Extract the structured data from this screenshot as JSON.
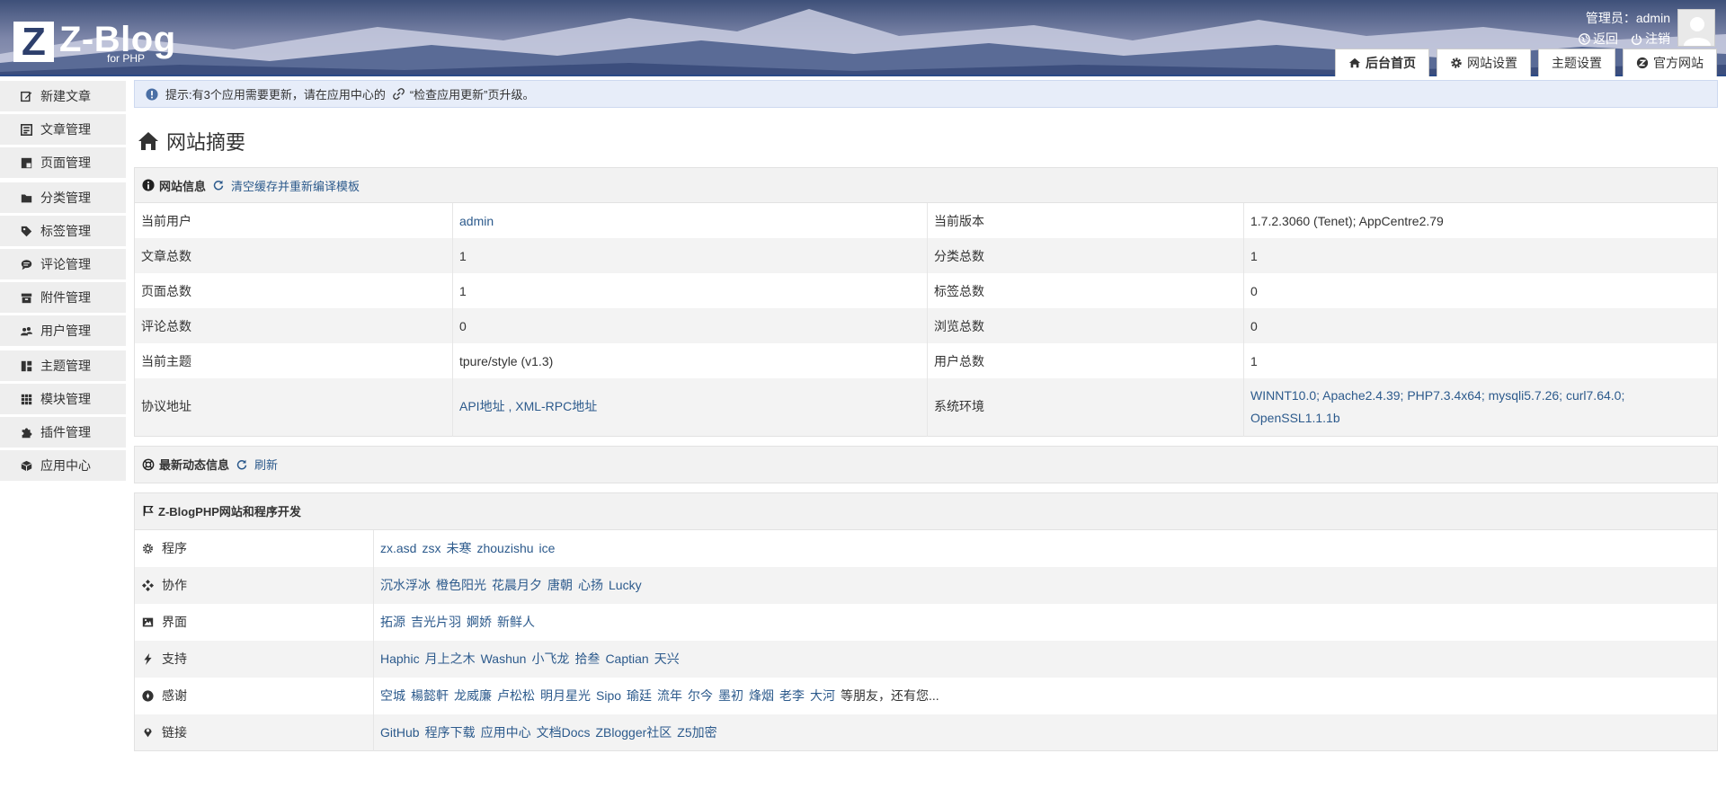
{
  "header": {
    "logo_text": "Z-Blog",
    "logo_z": "Z",
    "logo_sub": "for PHP",
    "admin_label": "管理员：admin",
    "back_link": "返回",
    "logout_link": "注销",
    "tabs": [
      {
        "label": "后台首页",
        "icon": "home-icon"
      },
      {
        "label": "网站设置",
        "icon": "gear-icon"
      },
      {
        "label": "主题设置",
        "icon": ""
      },
      {
        "label": "官方网站",
        "icon": "zblog-icon"
      }
    ]
  },
  "sidebar": {
    "items": [
      {
        "label": "新建文章",
        "icon": "edit-icon"
      },
      {
        "label": "文章管理",
        "icon": "article-icon"
      },
      {
        "label": "页面管理",
        "icon": "page-icon"
      },
      {
        "label": "分类管理",
        "icon": "folder-icon"
      },
      {
        "label": "标签管理",
        "icon": "tag-icon"
      },
      {
        "label": "评论管理",
        "icon": "comment-icon"
      },
      {
        "label": "附件管理",
        "icon": "archive-icon"
      },
      {
        "label": "用户管理",
        "icon": "users-icon"
      },
      {
        "label": "主题管理",
        "icon": "theme-icon"
      },
      {
        "label": "模块管理",
        "icon": "grid-icon"
      },
      {
        "label": "插件管理",
        "icon": "puzzle-icon"
      },
      {
        "label": "应用中心",
        "icon": "box-icon"
      }
    ]
  },
  "notice": {
    "text_before": "提示:有3个应用需要更新，请在应用中心的",
    "text_after": "“检查应用更新”页升级。"
  },
  "page_title": "网站摘要",
  "site_info": {
    "heading": "网站信息",
    "action": "清空缓存并重新编译模板",
    "rows": [
      {
        "k1": "当前用户",
        "v1": "admin",
        "k2": "当前版本",
        "v2": "1.7.2.3060 (Tenet); AppCentre2.79"
      },
      {
        "k1": "文章总数",
        "v1": "1",
        "k2": "分类总数",
        "v2": "1"
      },
      {
        "k1": "页面总数",
        "v1": "1",
        "k2": "标签总数",
        "v2": "0"
      },
      {
        "k1": "评论总数",
        "v1": "0",
        "k2": "浏览总数",
        "v2": "0"
      },
      {
        "k1": "当前主题",
        "v1": "tpure/style (v1.3)",
        "k2": "用户总数",
        "v2": "1"
      }
    ],
    "protocol_label": "协议地址",
    "protocol_value": "API地址 , XML-RPC地址",
    "env_label": "系统环境",
    "env_line1": "WINNT10.0; Apache2.4.39; PHP7.3.4x64; mysqli5.7.26; curl7.64.0;",
    "env_line2": "OpenSSL1.1.1b"
  },
  "news": {
    "heading": "最新动态信息",
    "action": "刷新"
  },
  "credits": {
    "heading": "Z-BlogPHP网站和程序开发",
    "rows": [
      {
        "label": "程序",
        "icon": "gear-icon",
        "names": [
          "zx.asd",
          "zsx",
          "未寒",
          "zhouzishu",
          "ice"
        ]
      },
      {
        "label": "协作",
        "icon": "diamonds-icon",
        "names": [
          "沉水浮冰",
          "橙色阳光",
          "花晨月夕",
          "唐朝",
          "心扬",
          "Lucky"
        ]
      },
      {
        "label": "界面",
        "icon": "image-icon",
        "names": [
          "拓源",
          "吉光片羽",
          "婀娇",
          "新鲜人"
        ]
      },
      {
        "label": "支持",
        "icon": "bolt-icon",
        "names": [
          "Haphic",
          "月上之木",
          "Washun",
          "小飞龙",
          "拾叁",
          "Captian",
          "天兴"
        ]
      },
      {
        "label": "感谢",
        "icon": "heart-icon",
        "names": [
          "空城",
          "楊懿軒",
          "龙威廉",
          "卢松松",
          "明月星光",
          "Sipo",
          "瑜廷",
          "流年",
          "尔今",
          "墨初",
          "烽烟",
          "老李",
          "大河"
        ],
        "suffix": "等朋友，还有您..."
      },
      {
        "label": "链接",
        "icon": "pin-icon",
        "names": [
          "GitHub",
          "程序下载",
          "应用中心",
          "文档Docs",
          "ZBlogger社区",
          "Z5加密"
        ]
      }
    ]
  }
}
